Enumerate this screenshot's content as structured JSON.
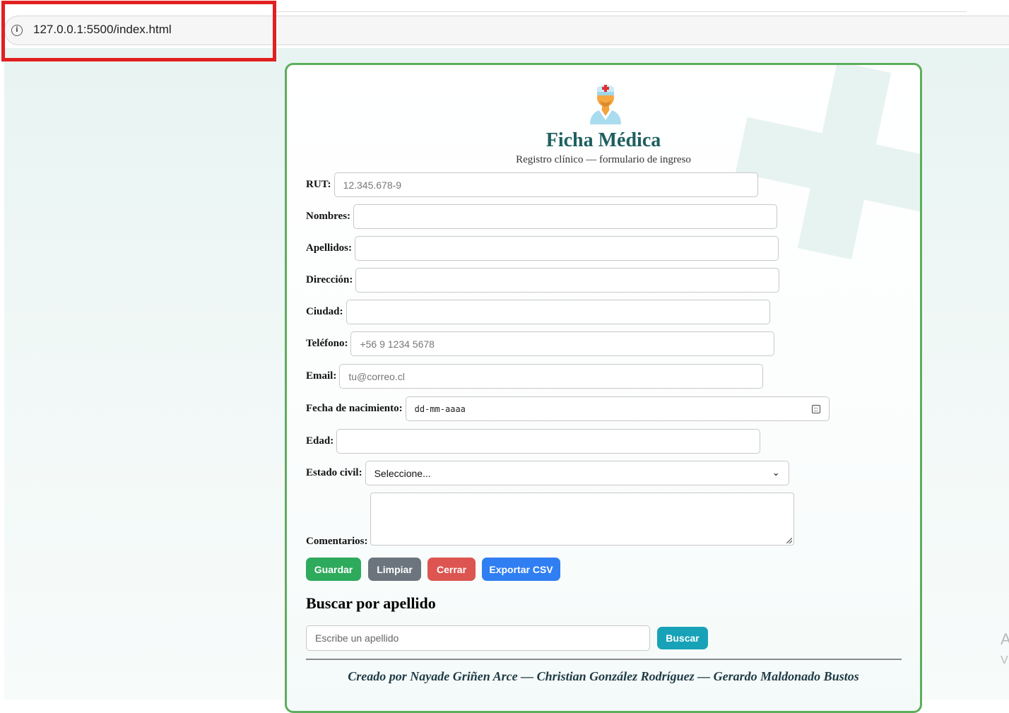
{
  "browser": {
    "url": "127.0.0.1:5500/index.html"
  },
  "header": {
    "title": "Ficha Médica",
    "subtitle": "Registro clínico — formulario de ingreso"
  },
  "form": {
    "rut": {
      "label": "RUT:",
      "placeholder": "12.345.678-9"
    },
    "nombres": {
      "label": "Nombres:",
      "placeholder": ""
    },
    "apellidos": {
      "label": "Apellidos:",
      "placeholder": ""
    },
    "direccion": {
      "label": "Dirección:",
      "placeholder": ""
    },
    "ciudad": {
      "label": "Ciudad:",
      "placeholder": ""
    },
    "telefono": {
      "label": "Teléfono:",
      "placeholder": "+56 9 1234 5678"
    },
    "email": {
      "label": "Email:",
      "placeholder": "tu@correo.cl"
    },
    "fecha_nacimiento": {
      "label": "Fecha de nacimiento:",
      "placeholder": "dd-mm-aaaa"
    },
    "edad": {
      "label": "Edad:",
      "placeholder": ""
    },
    "estado_civil": {
      "label": "Estado civil:",
      "selected": "Seleccione..."
    },
    "comentarios": {
      "label": "Comentarios:"
    }
  },
  "buttons": {
    "guardar": {
      "label": "Guardar",
      "color": "#2eaa5c"
    },
    "limpiar": {
      "label": "Limpiar",
      "color": "#6c757d"
    },
    "cerrar": {
      "label": "Cerrar",
      "color": "#dc5550"
    },
    "exportar": {
      "label": "Exportar CSV",
      "color": "#2f7ef2"
    }
  },
  "search": {
    "heading": "Buscar por apellido",
    "placeholder": "Escribe un apellido",
    "button_label": "Buscar",
    "button_color": "#17a2b8"
  },
  "footer": {
    "credits": "Creado por Nayade Griñen Arce — Christian González Rodríguez — Gerardo Maldonado Bustos"
  },
  "edge_glyphs": {
    "line1": "A",
    "line2": "V"
  },
  "colors": {
    "card_border": "#5cae5c",
    "title": "#1e5f5f",
    "highlight_box": "#e12020"
  }
}
